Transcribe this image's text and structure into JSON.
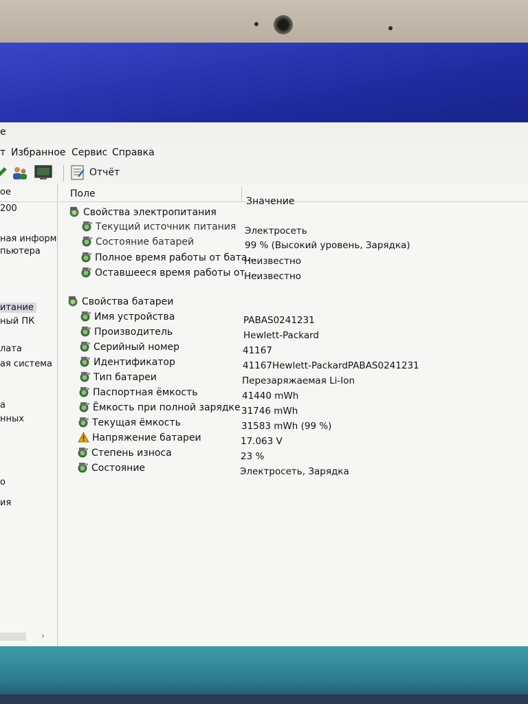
{
  "window": {
    "title_fragment": "е"
  },
  "menubar": {
    "items": [
      "т",
      "Избранное",
      "Сервис",
      "Справка"
    ]
  },
  "toolbar": {
    "report_label": "Отчёт"
  },
  "sidebar": {
    "header": "ое",
    "items": [
      {
        "label": "200",
        "selected": false
      },
      {
        "label": "ная информа",
        "selected": false
      },
      {
        "label": "пьютера",
        "selected": false
      },
      {
        "label": "итание",
        "selected": true
      },
      {
        "label": "ный ПК",
        "selected": false
      },
      {
        "label": "лата",
        "selected": false
      },
      {
        "label": "ая система",
        "selected": false
      },
      {
        "label": "а",
        "selected": false
      },
      {
        "label": "нных",
        "selected": false
      },
      {
        "label": "о",
        "selected": false
      },
      {
        "label": "ия",
        "selected": false
      }
    ],
    "scroll_arrow": "›"
  },
  "columns": {
    "field": "Поле",
    "value": "Значение"
  },
  "power": {
    "group": "Свойства электропитания",
    "rows": [
      {
        "field": "Текущий источник питания",
        "value": "Электросеть"
      },
      {
        "field": "Состояние батарей",
        "value": "99 % (Высокий уровень, Зарядка)"
      },
      {
        "field": "Полное время работы от бата...",
        "value": "Неизвестно"
      },
      {
        "field": "Оставшееся время работы от ...",
        "value": "Неизвестно"
      }
    ]
  },
  "battery": {
    "group": "Свойства батареи",
    "rows": [
      {
        "field": "Имя устройства",
        "value": "PABAS0241231",
        "icon": "battery-icon"
      },
      {
        "field": "Производитель",
        "value": "Hewlett-Packard",
        "icon": "battery-icon"
      },
      {
        "field": "Серийный номер",
        "value": "41167",
        "icon": "battery-icon"
      },
      {
        "field": "Идентификатор",
        "value": "41167Hewlett-PackardPABAS0241231",
        "icon": "battery-icon"
      },
      {
        "field": "Тип батареи",
        "value": "Перезаряжаемая Li-Ion",
        "icon": "battery-icon"
      },
      {
        "field": "Паспортная ёмкость",
        "value": "41440 mWh",
        "icon": "battery-icon"
      },
      {
        "field": "Ёмкость при полной зарядке",
        "value": "31746 mWh",
        "icon": "battery-icon"
      },
      {
        "field": "Текущая ёмкость",
        "value": "31583 mWh  (99 %)",
        "icon": "battery-icon"
      },
      {
        "field": "Напряжение батареи",
        "value": "17.063 V",
        "icon": "warning-icon"
      },
      {
        "field": "Степень износа",
        "value": "23 %",
        "icon": "battery-icon"
      },
      {
        "field": "Состояние",
        "value": "Электросеть, Зарядка",
        "icon": "battery-icon"
      }
    ]
  }
}
